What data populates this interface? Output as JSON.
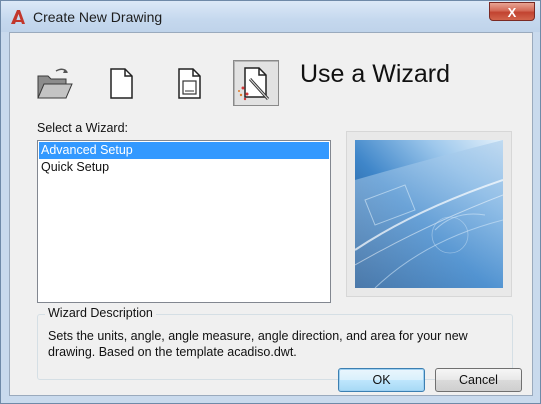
{
  "window": {
    "title": "Create New Drawing",
    "close_label": "X",
    "app_icon": "autocad-logo-icon",
    "colors": {
      "accent": "#c2362b",
      "selection": "#3399ff",
      "frame": "#c9daed"
    }
  },
  "toolbar": {
    "buttons": [
      {
        "name": "open-drawing",
        "icon": "folder-icon",
        "active": false
      },
      {
        "name": "start-from-scratch",
        "icon": "blank-page-icon",
        "active": false
      },
      {
        "name": "use-template",
        "icon": "template-page-icon",
        "active": false
      },
      {
        "name": "use-wizard",
        "icon": "wizard-icon",
        "active": true
      }
    ]
  },
  "heading": "Use a Wizard",
  "wizard_list": {
    "label": "Select a Wizard:",
    "items": [
      "Advanced Setup",
      "Quick Setup"
    ],
    "selected": "Advanced Setup"
  },
  "description": {
    "legend": "Wizard Description",
    "text": "Sets the units, angle, angle measure, angle direction, and area for your new drawing. Based on the template acadiso.dwt."
  },
  "buttons": {
    "ok": "OK",
    "cancel": "Cancel"
  }
}
